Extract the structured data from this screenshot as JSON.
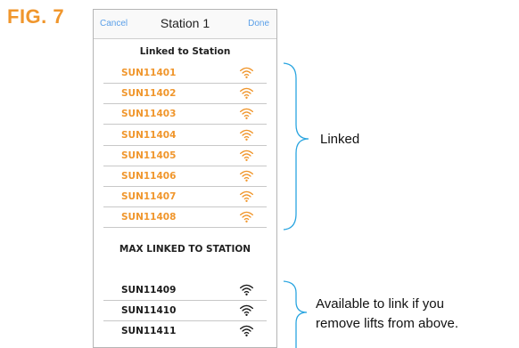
{
  "figure": {
    "label": "FIG. 7"
  },
  "navbar": {
    "cancel_label": "Cancel",
    "title": "Station 1",
    "done_label": "Done"
  },
  "colors": {
    "linked": "#f0962c",
    "available": "#1a1a1a",
    "accent": "#5a9fe8",
    "brace": "#2aa5e0"
  },
  "linked_section": {
    "header": "Linked to Station",
    "items": [
      {
        "name": "SUN11401",
        "icon": "wifi-icon"
      },
      {
        "name": "SUN11402",
        "icon": "wifi-icon"
      },
      {
        "name": "SUN11403",
        "icon": "wifi-icon"
      },
      {
        "name": "SUN11404",
        "icon": "wifi-icon"
      },
      {
        "name": "SUN11405",
        "icon": "wifi-icon"
      },
      {
        "name": "SUN11406",
        "icon": "wifi-icon"
      },
      {
        "name": "SUN11407",
        "icon": "wifi-icon"
      },
      {
        "name": "SUN11408",
        "icon": "wifi-icon"
      }
    ]
  },
  "max_label": "MAX LINKED TO STATION",
  "available_section": {
    "items": [
      {
        "name": "SUN11409",
        "icon": "wifi-icon"
      },
      {
        "name": "SUN11410",
        "icon": "wifi-icon"
      },
      {
        "name": "SUN11411",
        "icon": "wifi-icon"
      }
    ]
  },
  "annotations": {
    "linked": "Linked",
    "available_line1": "Available to link if you",
    "available_line2": "remove lifts from above."
  }
}
